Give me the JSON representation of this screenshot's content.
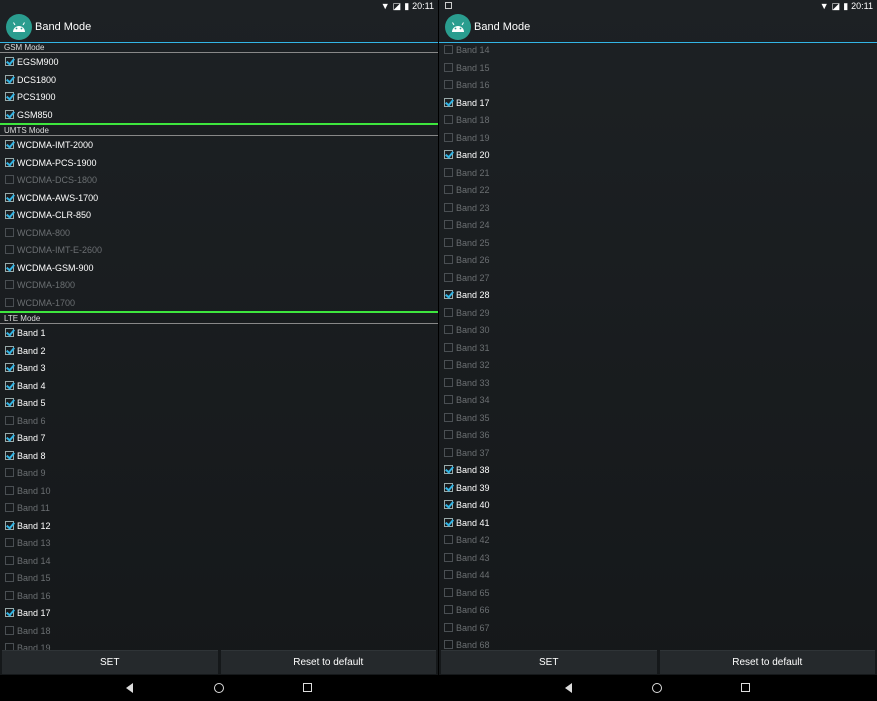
{
  "status": {
    "time": "20:11",
    "wifi_icon": "wifi-icon",
    "signal_icon": "no-signal-icon",
    "battery_icon": "battery-icon"
  },
  "app": {
    "title": "Band Mode",
    "icon": "android-icon"
  },
  "buttons": {
    "set": "SET",
    "reset": "Reset to default"
  },
  "left": {
    "gsm": {
      "header": "GSM Mode",
      "items": [
        {
          "label": "EGSM900",
          "checked": true
        },
        {
          "label": "DCS1800",
          "checked": true
        },
        {
          "label": "PCS1900",
          "checked": true
        },
        {
          "label": "GSM850",
          "checked": true
        }
      ]
    },
    "umts": {
      "header": "UMTS Mode",
      "items": [
        {
          "label": "WCDMA-IMT-2000",
          "checked": true
        },
        {
          "label": "WCDMA-PCS-1900",
          "checked": true
        },
        {
          "label": "WCDMA-DCS-1800",
          "checked": false
        },
        {
          "label": "WCDMA-AWS-1700",
          "checked": true
        },
        {
          "label": "WCDMA-CLR-850",
          "checked": true
        },
        {
          "label": "WCDMA-800",
          "checked": false
        },
        {
          "label": "WCDMA-IMT-E-2600",
          "checked": false
        },
        {
          "label": "WCDMA-GSM-900",
          "checked": true
        },
        {
          "label": "WCDMA-1800",
          "checked": false
        },
        {
          "label": "WCDMA-1700",
          "checked": false
        }
      ]
    },
    "lte": {
      "header": "LTE Mode",
      "items": [
        {
          "label": "Band 1",
          "checked": true
        },
        {
          "label": "Band 2",
          "checked": true
        },
        {
          "label": "Band 3",
          "checked": true
        },
        {
          "label": "Band 4",
          "checked": true
        },
        {
          "label": "Band 5",
          "checked": true
        },
        {
          "label": "Band 6",
          "checked": false
        },
        {
          "label": "Band 7",
          "checked": true
        },
        {
          "label": "Band 8",
          "checked": true
        },
        {
          "label": "Band 9",
          "checked": false
        },
        {
          "label": "Band 10",
          "checked": false
        },
        {
          "label": "Band 11",
          "checked": false
        },
        {
          "label": "Band 12",
          "checked": true
        },
        {
          "label": "Band 13",
          "checked": false
        },
        {
          "label": "Band 14",
          "checked": false
        },
        {
          "label": "Band 15",
          "checked": false
        },
        {
          "label": "Band 16",
          "checked": false
        },
        {
          "label": "Band 17",
          "checked": true
        },
        {
          "label": "Band 18",
          "checked": false
        },
        {
          "label": "Band 19",
          "checked": false
        }
      ]
    }
  },
  "right": {
    "items": [
      {
        "label": "Band 14",
        "checked": false
      },
      {
        "label": "Band 15",
        "checked": false
      },
      {
        "label": "Band 16",
        "checked": false
      },
      {
        "label": "Band 17",
        "checked": true
      },
      {
        "label": "Band 18",
        "checked": false
      },
      {
        "label": "Band 19",
        "checked": false
      },
      {
        "label": "Band 20",
        "checked": true
      },
      {
        "label": "Band 21",
        "checked": false
      },
      {
        "label": "Band 22",
        "checked": false
      },
      {
        "label": "Band 23",
        "checked": false
      },
      {
        "label": "Band 24",
        "checked": false
      },
      {
        "label": "Band 25",
        "checked": false
      },
      {
        "label": "Band 26",
        "checked": false
      },
      {
        "label": "Band 27",
        "checked": false
      },
      {
        "label": "Band 28",
        "checked": true
      },
      {
        "label": "Band 29",
        "checked": false
      },
      {
        "label": "Band 30",
        "checked": false
      },
      {
        "label": "Band 31",
        "checked": false
      },
      {
        "label": "Band 32",
        "checked": false
      },
      {
        "label": "Band 33",
        "checked": false
      },
      {
        "label": "Band 34",
        "checked": false
      },
      {
        "label": "Band 35",
        "checked": false
      },
      {
        "label": "Band 36",
        "checked": false
      },
      {
        "label": "Band 37",
        "checked": false
      },
      {
        "label": "Band 38",
        "checked": true
      },
      {
        "label": "Band 39",
        "checked": true
      },
      {
        "label": "Band 40",
        "checked": true
      },
      {
        "label": "Band 41",
        "checked": true
      },
      {
        "label": "Band 42",
        "checked": false
      },
      {
        "label": "Band 43",
        "checked": false
      },
      {
        "label": "Band 44",
        "checked": false
      },
      {
        "label": "Band 65",
        "checked": false
      },
      {
        "label": "Band 66",
        "checked": false
      },
      {
        "label": "Band 67",
        "checked": false
      },
      {
        "label": "Band 68",
        "checked": false
      }
    ]
  },
  "nav": {
    "back": "back-icon",
    "home": "home-icon",
    "recents": "recents-icon"
  },
  "colors": {
    "accent": "#33b5e5",
    "separator": "#3ee63e"
  }
}
